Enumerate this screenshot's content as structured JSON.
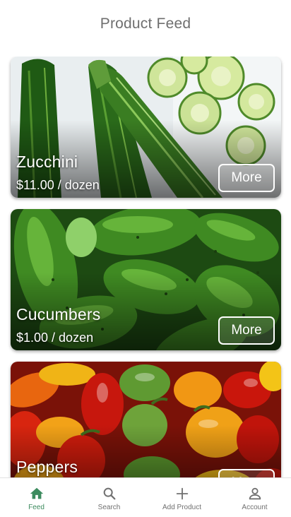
{
  "header": {
    "title": "Product Feed"
  },
  "products": [
    {
      "name": "Zucchini",
      "price": "$11.00 / dozen",
      "more_label": "More",
      "image": "zucchini-photo"
    },
    {
      "name": "Cucumbers",
      "price": "$1.00 / dozen",
      "more_label": "More",
      "image": "cucumbers-photo"
    },
    {
      "name": "Peppers",
      "price": "",
      "more_label": "More",
      "image": "peppers-photo"
    }
  ],
  "nav": {
    "active": "feed",
    "active_color": "#3c8b5e",
    "inactive_color": "#707070",
    "items": [
      {
        "label": "Feed",
        "icon": "home-icon"
      },
      {
        "label": "Search",
        "icon": "search-icon"
      },
      {
        "label": "Add Product",
        "icon": "plus-icon"
      },
      {
        "label": "Account",
        "icon": "person-icon"
      }
    ]
  }
}
